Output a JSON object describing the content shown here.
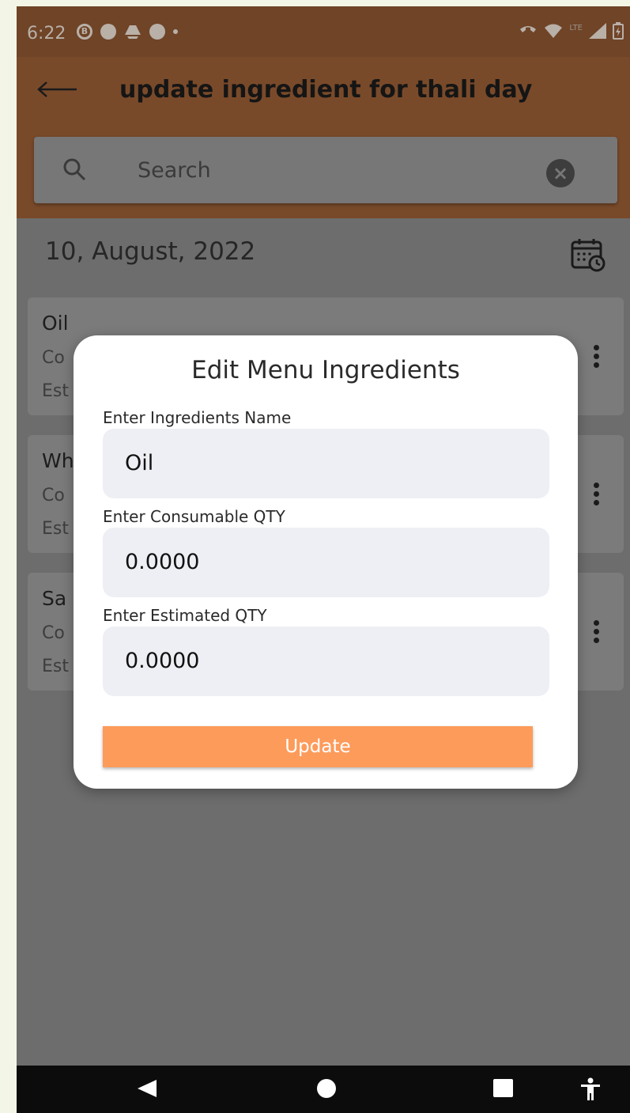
{
  "status_bar": {
    "time": "6:22",
    "icons": [
      "b-circle-icon",
      "p-circle-icon",
      "drive-icon",
      "facebook-icon",
      "dot-icon"
    ],
    "right_icons": [
      "call-icon",
      "wifi-icon",
      "lte-icon",
      "signal-icon",
      "battery-icon"
    ],
    "lte": "LTE"
  },
  "appbar": {
    "title": "update ingredient for thali day",
    "search_placeholder": "Search"
  },
  "date": "10, August, 2022",
  "cards": [
    {
      "name": "Oil",
      "line2": "Co",
      "line3": "Est"
    },
    {
      "name": "Wh",
      "line2": "Co",
      "line3": "Est"
    },
    {
      "name": "Sa",
      "line2": "Co",
      "line3": "Est"
    }
  ],
  "dialog": {
    "title": "Edit Menu Ingredients",
    "name_label": "Enter Ingredients Name",
    "name_value": "Oil",
    "consumable_label": "Enter Consumable QTY",
    "consumable_value": "0.0000",
    "estimated_label": "Enter Estimated QTY",
    "estimated_value": "0.0000",
    "button": "Update"
  },
  "colors": {
    "accent": "#fd9b5b",
    "appbar": "#794a2a"
  }
}
